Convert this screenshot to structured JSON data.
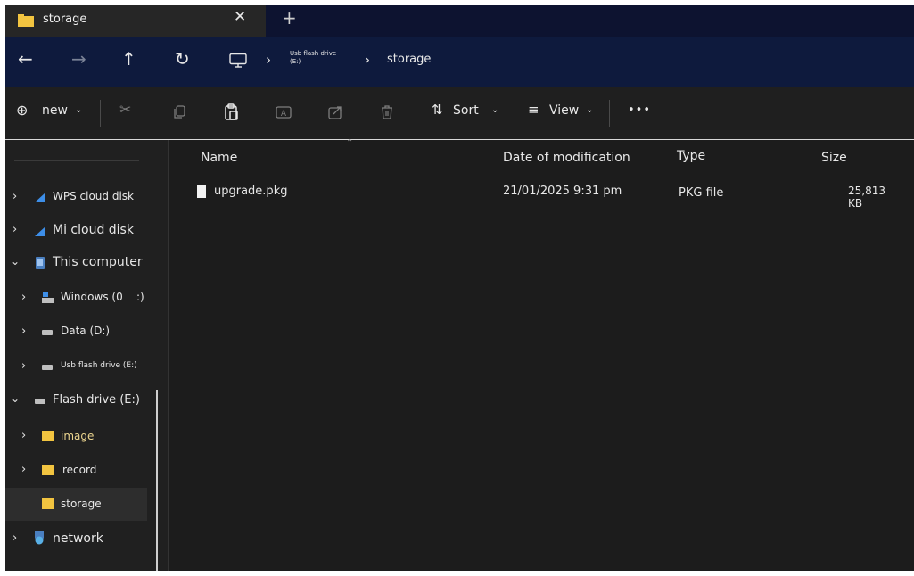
{
  "tab": {
    "title": "storage"
  },
  "address": {
    "drive_crumb": "Usb flash drive",
    "drive_crumb_letter": "(E:)",
    "folder_crumb": "storage"
  },
  "toolbar": {
    "new_label": "new",
    "sort_label": "Sort",
    "view_label": "View",
    "more_label": "•••"
  },
  "sidebar": {
    "items": [
      {
        "label": "WPS cloud disk"
      },
      {
        "label": "Mi cloud disk"
      },
      {
        "label": "This computer"
      },
      {
        "label": "Windows (0    :)"
      },
      {
        "label": "Data (D:)"
      },
      {
        "label": "Usb flash drive (E:)"
      },
      {
        "label": "Flash drive (E:)"
      },
      {
        "label": "image"
      },
      {
        "label": "record"
      },
      {
        "label": "storage"
      },
      {
        "label": "network"
      }
    ]
  },
  "columns": {
    "name": "Name",
    "date": "Date of modification",
    "type": "Type",
    "size": "Size"
  },
  "files": [
    {
      "name": "upgrade.pkg",
      "date": "21/01/2025 9:31 pm",
      "type": "PKG file",
      "size": "25,813 KB"
    }
  ],
  "colors": {
    "titlebar": "#0d1330",
    "addressbar": "#0e1a3d",
    "toolbar": "#1f1f1f",
    "sidebar": "#202020",
    "content": "#1c1c1c",
    "folder": "#f2c440",
    "cloud": "#3d8ee8"
  }
}
